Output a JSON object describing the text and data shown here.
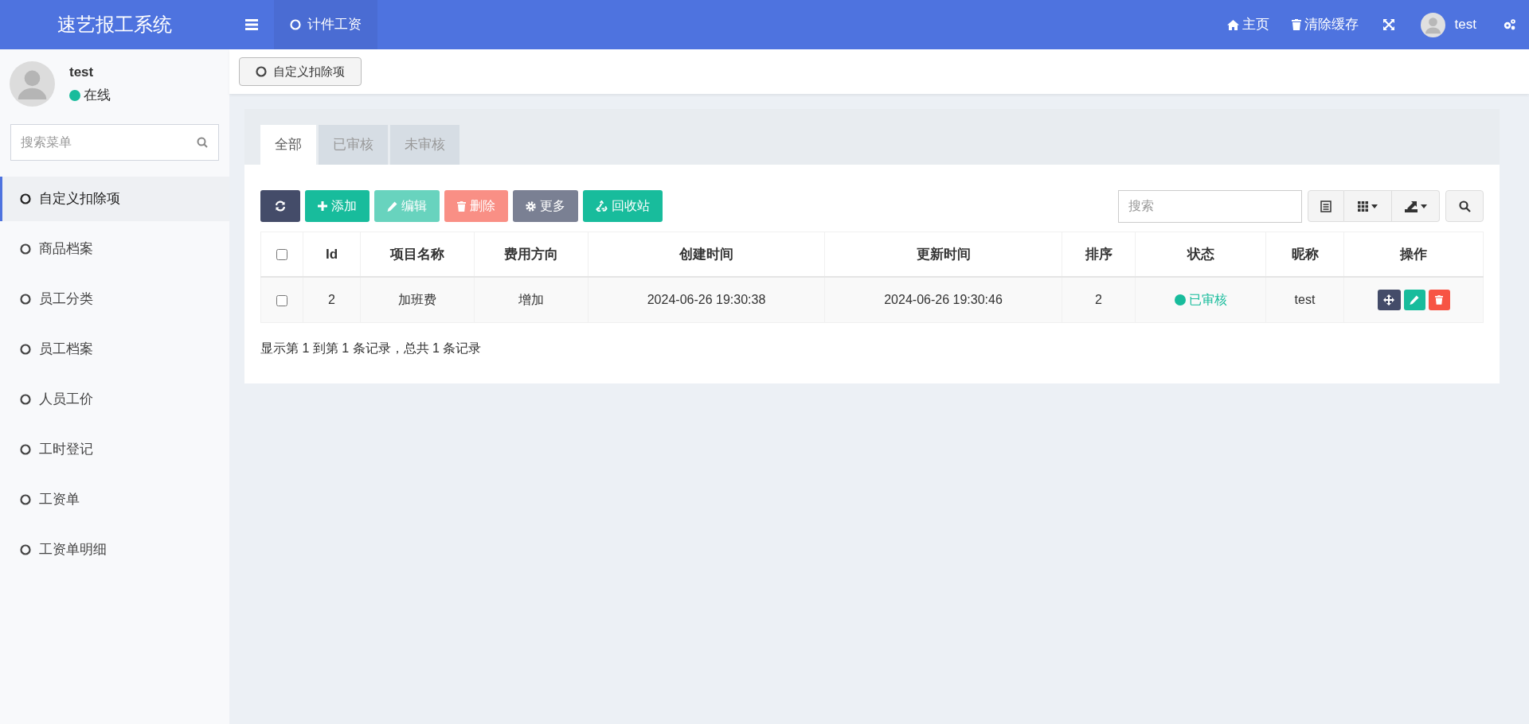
{
  "header": {
    "logo": "速艺报工系统",
    "nav_tabs": [
      {
        "label": "计件工资",
        "selected": true
      }
    ],
    "links": [
      {
        "kind": "home",
        "label": "主页"
      },
      {
        "kind": "trash",
        "label": "清除缓存"
      }
    ],
    "user": "test"
  },
  "sidebar": {
    "user": {
      "name": "test",
      "status": "在线"
    },
    "search": {
      "placeholder": "搜索菜单"
    },
    "menu": [
      {
        "label": "自定义扣除项",
        "selected": true
      },
      {
        "label": "商品档案",
        "selected": false
      },
      {
        "label": "员工分类",
        "selected": false
      },
      {
        "label": "员工档案",
        "selected": false
      },
      {
        "label": "人员工价",
        "selected": false
      },
      {
        "label": "工时登记",
        "selected": false
      },
      {
        "label": "工资单",
        "selected": false
      },
      {
        "label": "工资单明细",
        "selected": false
      }
    ]
  },
  "page_tabs": [
    {
      "label": "自定义扣除项",
      "selected": true
    }
  ],
  "panel": {
    "tabs": [
      {
        "label": "全部",
        "selected": true
      },
      {
        "label": "已审核",
        "selected": false
      },
      {
        "label": "未审核",
        "selected": false
      }
    ],
    "toolbar": [
      {
        "kind": "refresh",
        "disabled": false
      },
      {
        "kind": "add",
        "label": "添加",
        "disabled": false
      },
      {
        "kind": "edit",
        "label": "编辑",
        "disabled": true
      },
      {
        "kind": "delete",
        "label": "删除",
        "disabled": true
      },
      {
        "kind": "more",
        "label": "更多",
        "disabled": false
      },
      {
        "kind": "recycle",
        "label": "回收站",
        "disabled": false
      }
    ],
    "search": {
      "placeholder": "搜索"
    },
    "table": {
      "select_all": false,
      "columns": [
        "Id",
        "项目名称",
        "费用方向",
        "创建时间",
        "更新时间",
        "排序",
        "状态",
        "昵称",
        "操作"
      ],
      "rows": [
        {
          "checked": false,
          "cells": [
            "2",
            "加班费",
            "增加",
            "2024-06-26 19:30:38",
            "2024-06-26 19:30:46",
            "2"
          ],
          "status": {
            "label": "已审核",
            "color": "#18bc9c"
          },
          "nickname": "test"
        }
      ]
    },
    "footer": "显示第 1 到第 1 条记录，总共 1 条记录"
  }
}
